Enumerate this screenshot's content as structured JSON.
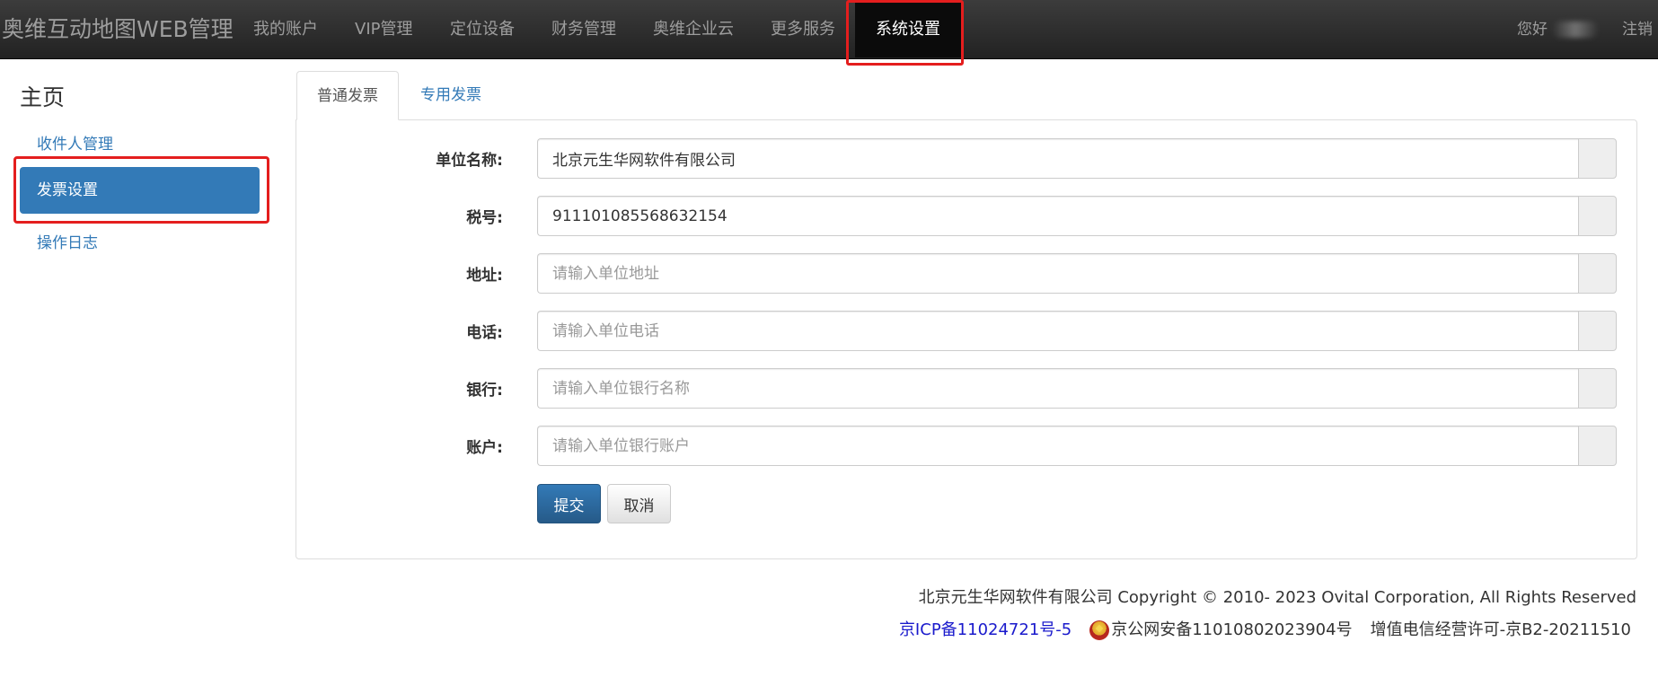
{
  "navbar": {
    "brand": "奥维互动地图WEB管理",
    "items": [
      {
        "label": "我的账户"
      },
      {
        "label": "VIP管理"
      },
      {
        "label": "定位设备"
      },
      {
        "label": "财务管理"
      },
      {
        "label": "奥维企业云"
      },
      {
        "label": "更多服务"
      }
    ],
    "active_item": "系统设置",
    "greeting": "您好",
    "logout": "注销"
  },
  "sidebar": {
    "title": "主页",
    "items": [
      {
        "label": "收件人管理"
      },
      {
        "label": "发票设置"
      },
      {
        "label": "操作日志"
      }
    ],
    "active_index": 1
  },
  "tabs": [
    {
      "label": "普通发票",
      "active": true
    },
    {
      "label": "专用发票",
      "active": false
    }
  ],
  "form": {
    "fields": [
      {
        "label": "单位名称:",
        "value": "北京元生华网软件有限公司",
        "placeholder": ""
      },
      {
        "label": "税号:",
        "value": "911101085568632154",
        "placeholder": ""
      },
      {
        "label": "地址:",
        "value": "",
        "placeholder": "请输入单位地址"
      },
      {
        "label": "电话:",
        "value": "",
        "placeholder": "请输入单位电话"
      },
      {
        "label": "银行:",
        "value": "",
        "placeholder": "请输入单位银行名称"
      },
      {
        "label": "账户:",
        "value": "",
        "placeholder": "请输入单位银行账户"
      }
    ],
    "submit_label": "提交",
    "cancel_label": "取消"
  },
  "footer": {
    "copyright": "北京元生华网软件有限公司 Copyright © 2010- 2023 Ovital Corporation, All Rights Reserved",
    "icp": "京ICP备11024721号-5",
    "gongan": "京公网安备11010802023904号",
    "license": "增值电信经营许可-京B2-20211510"
  },
  "colors": {
    "navbar_bg": "#222222",
    "primary": "#337ab7",
    "highlight_border": "#e41e1e",
    "icp_link": "#1a1acc"
  }
}
